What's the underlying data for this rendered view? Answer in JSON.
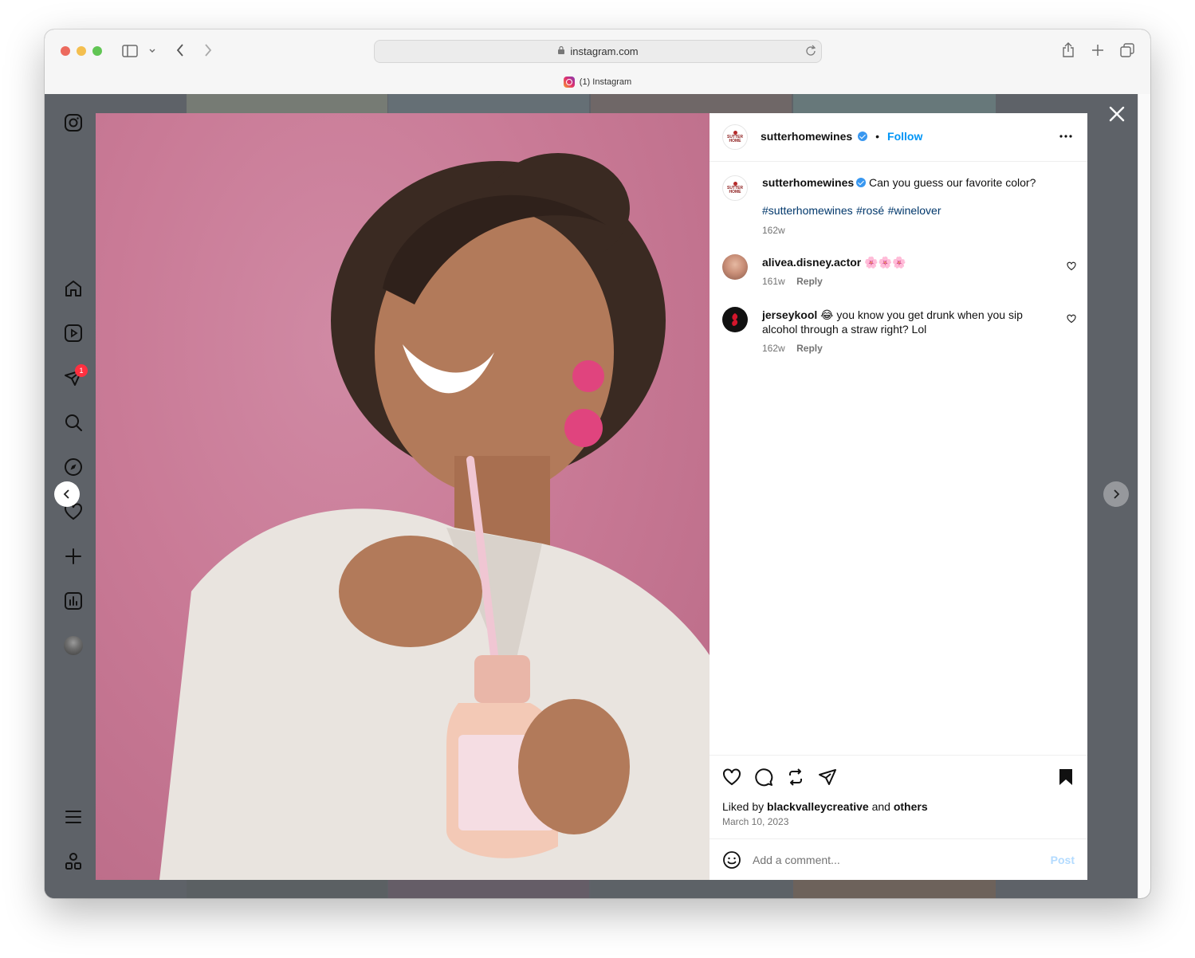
{
  "browser": {
    "url": "instagram.com",
    "tab_title": "(1) Instagram"
  },
  "sidebar": {
    "notification_count": "1"
  },
  "post": {
    "username": "sutterhomewines",
    "follow_label": "Follow",
    "avatar_text_top": "SUTTER",
    "avatar_text_bottom": "HOME",
    "caption": {
      "username": "sutterhomewines",
      "text": "Can you guess our favorite color?",
      "hashtags": [
        "#sutterhomewines",
        "#rosé",
        "#winelover"
      ],
      "time": "162w"
    },
    "comments": [
      {
        "username": "alivea.disney.actor",
        "text": "🌸🌸🌸",
        "time": "161w",
        "reply_label": "Reply"
      },
      {
        "username": "jerseykool",
        "text": "😂 you know you get drunk when you sip alcohol through a straw right? Lol",
        "time": "162w",
        "reply_label": "Reply"
      }
    ],
    "likes": {
      "prefix": "Liked by",
      "user": "blackvalleycreative",
      "and": "and",
      "others": "others"
    },
    "date": "March 10, 2023",
    "comment_placeholder": "Add a comment...",
    "post_label": "Post"
  },
  "colors": {
    "accent": "#0095f6",
    "verified": "#3897f0",
    "photo_background": "#c97a96"
  }
}
